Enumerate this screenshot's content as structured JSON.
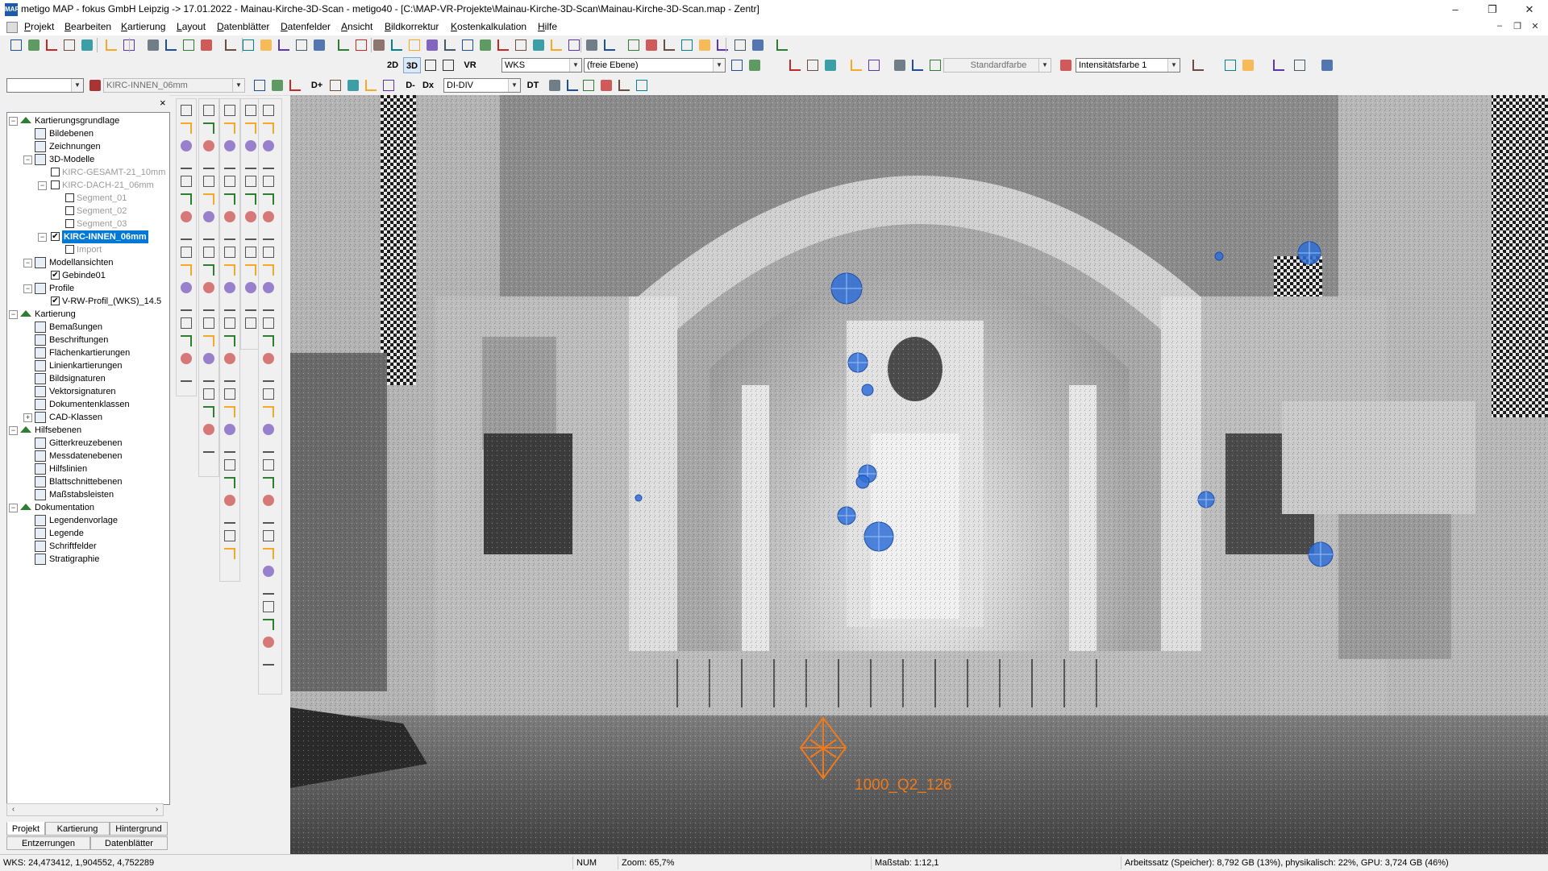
{
  "window": {
    "title": "metigo MAP - fokus GmbH Leipzig -> 17.01.2022 - Mainau-Kirche-3D-Scan - metigo40 - [C:\\MAP-VR-Projekte\\Mainau-Kirche-3D-Scan\\Mainau-Kirche-3D-Scan.map - Zentr]",
    "app_icon_text": "MAP",
    "minimize": "–",
    "maximize": "❐",
    "close": "✕",
    "mdi_minimize": "–",
    "mdi_restore": "❐",
    "mdi_close": "✕"
  },
  "menu": [
    "Projekt",
    "Bearbeiten",
    "Kartierung",
    "Layout",
    "Datenblätter",
    "Datenfelder",
    "Ansicht",
    "Bildkorrektur",
    "Kostenkalkulation",
    "Hilfe"
  ],
  "toolbar2": {
    "mode_2d": "2D",
    "mode_3d": "3D",
    "mode_vr": "VR",
    "coord_system": "WKS",
    "plane": "(freie Ebene)",
    "color_mode": "Standardfarbe",
    "intensity": "Intensitätsfarbe 1"
  },
  "toolbar3": {
    "layer_combo": "",
    "model_combo": "KIRC-INNEN_06mm",
    "di_plus": "D+",
    "di_minus": "D-",
    "di_x": "Dx",
    "di_combo": "DI-DIV",
    "dt": "DT"
  },
  "tree": {
    "close_glyph": "×",
    "items": [
      {
        "label": "Kartierungsgrundlage",
        "level": 0,
        "exp": "−",
        "icon": "house-icon"
      },
      {
        "label": "Bildebenen",
        "level": 1,
        "icon": "image-layer-icon"
      },
      {
        "label": "Zeichnungen",
        "level": 1,
        "icon": "drawing-icon"
      },
      {
        "label": "3D-Modelle",
        "level": 1,
        "exp": "−",
        "icon": "model-3d-icon"
      },
      {
        "label": "KIRC-GESAMT-21_10mm",
        "level": 2,
        "chk": "",
        "dim": true
      },
      {
        "label": "KIRC-DACH-21_06mm",
        "level": 2,
        "exp": "−",
        "chk": "",
        "dim": true
      },
      {
        "label": "Segment_01",
        "level": 3,
        "chk": "",
        "dim": true
      },
      {
        "label": "Segment_02",
        "level": 3,
        "chk": "",
        "dim": true
      },
      {
        "label": "Segment_03",
        "level": 3,
        "chk": "",
        "dim": true
      },
      {
        "label": "KIRC-INNEN_06mm",
        "level": 2,
        "exp": "−",
        "chk": "✔",
        "sel": true
      },
      {
        "label": "Import",
        "level": 3,
        "chk": "",
        "dim": true
      },
      {
        "label": "Modellansichten",
        "level": 1,
        "exp": "−",
        "icon": "model-views-icon"
      },
      {
        "label": "Gebinde01",
        "level": 2,
        "chk": "✔"
      },
      {
        "label": "Profile",
        "level": 1,
        "exp": "−",
        "icon": "profile-icon"
      },
      {
        "label": "V-RW-Profil_(WKS)_14.5",
        "level": 2,
        "chk": "✔"
      },
      {
        "label": "Kartierung",
        "level": 0,
        "exp": "−",
        "icon": "house-icon"
      },
      {
        "label": "Bemaßungen",
        "level": 1,
        "icon": "dimension-icon"
      },
      {
        "label": "Beschriftungen",
        "level": 1,
        "icon": "text-label-icon"
      },
      {
        "label": "Flächenkartierungen",
        "level": 1,
        "icon": "area-mapping-icon"
      },
      {
        "label": "Linienkartierungen",
        "level": 1,
        "icon": "line-mapping-icon"
      },
      {
        "label": "Bildsignaturen",
        "level": 1,
        "icon": "image-signature-icon"
      },
      {
        "label": "Vektorsignaturen",
        "level": 1,
        "icon": "vector-signature-icon"
      },
      {
        "label": "Dokumentenklassen",
        "level": 1,
        "icon": "document-class-icon"
      },
      {
        "label": "CAD-Klassen",
        "level": 1,
        "exp": "+",
        "icon": "cad-class-icon"
      },
      {
        "label": "Hilfsebenen",
        "level": 0,
        "exp": "−",
        "icon": "house-icon"
      },
      {
        "label": "Gitterkreuzebenen",
        "level": 1,
        "icon": "grid-cross-icon"
      },
      {
        "label": "Messdatenebenen",
        "level": 1,
        "icon": "measure-data-icon"
      },
      {
        "label": "Hilfslinien",
        "level": 1,
        "icon": "helper-lines-icon"
      },
      {
        "label": "Blattschnittebenen",
        "level": 1,
        "icon": "sheet-cut-icon"
      },
      {
        "label": "Maßstabsleisten",
        "level": 1,
        "icon": "scale-bar-icon"
      },
      {
        "label": "Dokumentation",
        "level": 0,
        "exp": "−",
        "icon": "house-icon"
      },
      {
        "label": "Legendenvorlage",
        "level": 1,
        "icon": "legend-template-icon"
      },
      {
        "label": "Legende",
        "level": 1,
        "icon": "legend-icon"
      },
      {
        "label": "Schriftfelder",
        "level": 1,
        "icon": "title-block-icon"
      },
      {
        "label": "Stratigraphie",
        "level": 1,
        "icon": "stratigraphy-icon"
      }
    ]
  },
  "scroll": {
    "left": "‹",
    "right": "›"
  },
  "panel_tabs_row1": [
    "Projekt",
    "Kartierung",
    "Hintergrund"
  ],
  "panel_tabs_row2": [
    "Entzerrungen",
    "Datenblätter"
  ],
  "viewport": {
    "marker_label": "1000_Q2_126",
    "marker_color": "#f07a1a",
    "target_color": "#2f6fd6"
  },
  "status": {
    "coords": "WKS: 24,473412, 1,904552, 4,752289",
    "num": "NUM",
    "zoom": "Zoom: 65,7%",
    "scale": "Maßstab: 1:12,1",
    "memory": "Arbeitssatz (Speicher): 8,792 GB (13%), physikalisch: 22%, GPU: 3,724 GB (46%)"
  }
}
